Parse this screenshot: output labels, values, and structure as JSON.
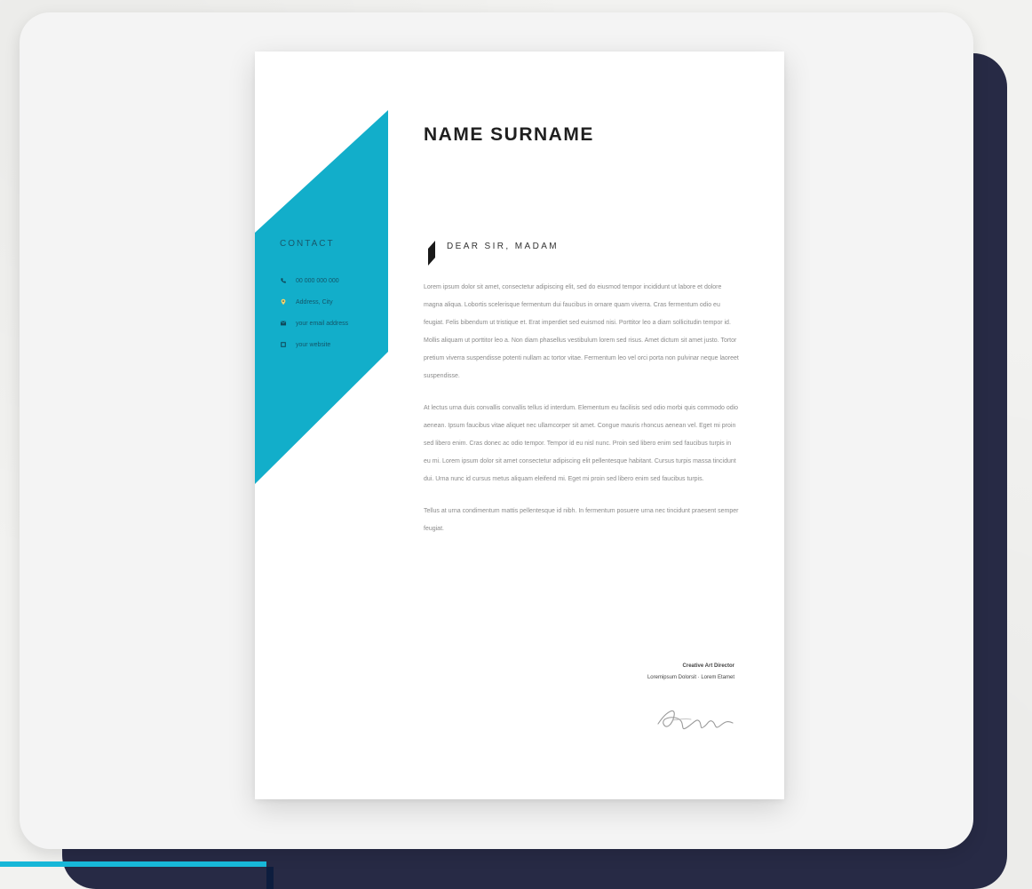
{
  "page": {
    "background": "#f2f2f0",
    "back_card_color": "#272a45",
    "front_card_color": "#f4f4f4",
    "accent_blue": "#17b7d8",
    "accent_navy": "#0d1d3e"
  },
  "document": {
    "name": "NAME SURNAME",
    "greeting": "DEAR SIR, MADAM",
    "contact_heading": "CONTACT",
    "contact_items": [
      {
        "icon": "phone-icon",
        "text": "00 000 000 000"
      },
      {
        "icon": "location-pin-icon",
        "text": "Address, City"
      },
      {
        "icon": "email-icon",
        "text": "your email address"
      },
      {
        "icon": "website-icon",
        "text": "your website"
      }
    ],
    "paragraphs": [
      "Lorem ipsum dolor sit amet, consectetur adipiscing elit, sed do eiusmod tempor incididunt ut labore et dolore magna aliqua. Lobortis scelerisque fermentum dui faucibus in ornare quam viverra. Cras fermentum odio eu feugiat. Felis bibendum ut tristique et. Erat imperdiet sed euismod nisi. Porttitor leo a diam sollicitudin tempor id. Mollis aliquam ut porttitor leo a. Non diam phasellus vestibulum lorem sed risus. Amet dictum sit amet justo. Tortor pretium viverra suspendisse potenti nullam ac tortor vitae. Fermentum leo vel orci porta non pulvinar neque laoreet suspendisse.",
      "At lectus urna duis convallis convallis tellus id interdum. Elementum eu facilisis sed odio morbi quis commodo odio aenean. Ipsum faucibus vitae aliquet nec ullamcorper sit amet. Congue mauris rhoncus aenean vel. Eget mi proin sed libero enim. Cras donec ac odio tempor. Tempor id eu nisl nunc. Proin sed libero enim sed faucibus turpis in eu mi. Lorem ipsum dolor sit amet consectetur adipiscing elit pellentesque habitant. Cursus turpis massa tincidunt dui. Urna nunc id cursus metus aliquam eleifend mi. Eget mi proin sed libero enim sed faucibus turpis.",
      "Tellus at urna condimentum mattis pellentesque id nibh. In fermentum posuere urna nec tincidunt praesent semper feugiat."
    ],
    "sign_name": "Creative Art Director",
    "sign_company": "Loremipsum Dolorsit · Lorem Etamet",
    "signature": "Signature",
    "panel_color": "#12aeca"
  }
}
